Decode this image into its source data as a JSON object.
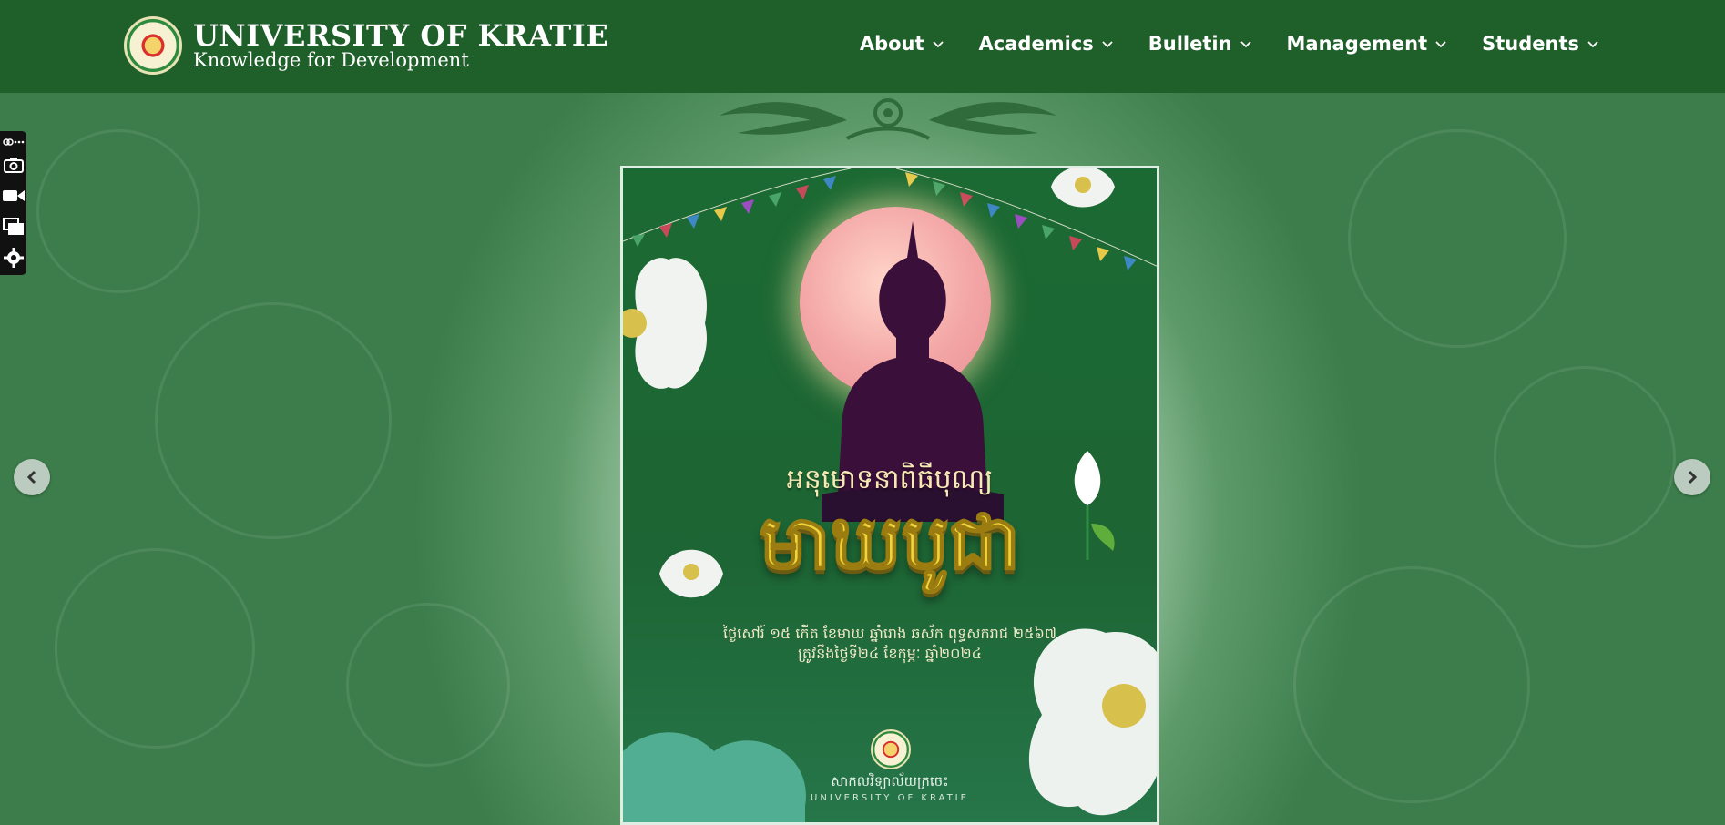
{
  "header": {
    "title": "UNIVERSITY OF KRATIE",
    "tagline": "Knowledge for Development",
    "nav": [
      {
        "label": "About"
      },
      {
        "label": "Academics"
      },
      {
        "label": "Bulletin"
      },
      {
        "label": "Management"
      },
      {
        "label": "Students"
      }
    ]
  },
  "poster": {
    "heading_line": "អនុមោទនាពិធីបុណ្យ",
    "title": "មាឃបូជា",
    "sub_line_1": "ថ្ងៃសៅរ៍ ១៥ កើត ខែមាឃ ឆ្នាំរោង ឆស័ក ពុទ្ធសករាជ ២៥៦៧",
    "sub_line_2": "ត្រូវនឹងថ្ងៃទី២៤ ខែកុម្ភៈ ឆ្នាំ២០២៤",
    "footer_khmer": "សាកលវិទ្យាល័យក្រចេះ",
    "footer_english": "UNIVERSITY OF KRATIE"
  },
  "icons": {
    "chevron": "chevron-down-icon",
    "prev": "chevron-left-icon",
    "next": "chevron-right-icon",
    "toolbar": [
      "link-icon",
      "more-icon",
      "camera-icon",
      "video-icon",
      "window-icon",
      "gear-icon"
    ]
  },
  "colors": {
    "header_bg": "#1f5f2a",
    "poster_bg": "#1c6a33",
    "title_gold": "#f1d43b",
    "moon": "#f3a6a6"
  }
}
